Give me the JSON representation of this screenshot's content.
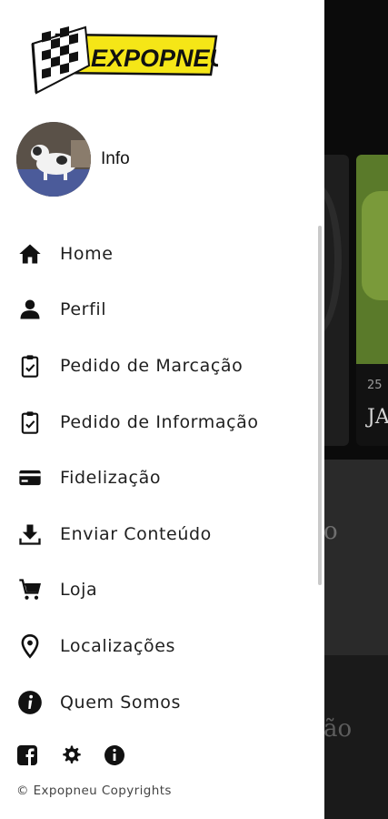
{
  "brand": {
    "logo_text": "EXPOPNEU",
    "accent": "#f5e617"
  },
  "profile": {
    "name": "Info"
  },
  "menu": [
    {
      "label": "Home",
      "icon": "home-icon"
    },
    {
      "label": "Perfil",
      "icon": "person-icon"
    },
    {
      "label": "Pedido de Marcação",
      "icon": "clipboard-check-icon"
    },
    {
      "label": "Pedido de Informação",
      "icon": "clipboard-check-icon"
    },
    {
      "label": "Fidelização",
      "icon": "credit-card-icon"
    },
    {
      "label": "Enviar Conteúdo",
      "icon": "download-tray-icon"
    },
    {
      "label": "Loja",
      "icon": "cart-icon"
    },
    {
      "label": "Localizações",
      "icon": "location-pin-icon"
    },
    {
      "label": "Quem Somos",
      "icon": "info-circle-icon"
    }
  ],
  "social": [
    "facebook-icon",
    "gear-icon",
    "info-icon"
  ],
  "copyright": "© Expopneu Copyrights",
  "background": {
    "card_date": "25",
    "card_title": "JA",
    "fragment_1": "o",
    "fragment_2": "ão"
  }
}
